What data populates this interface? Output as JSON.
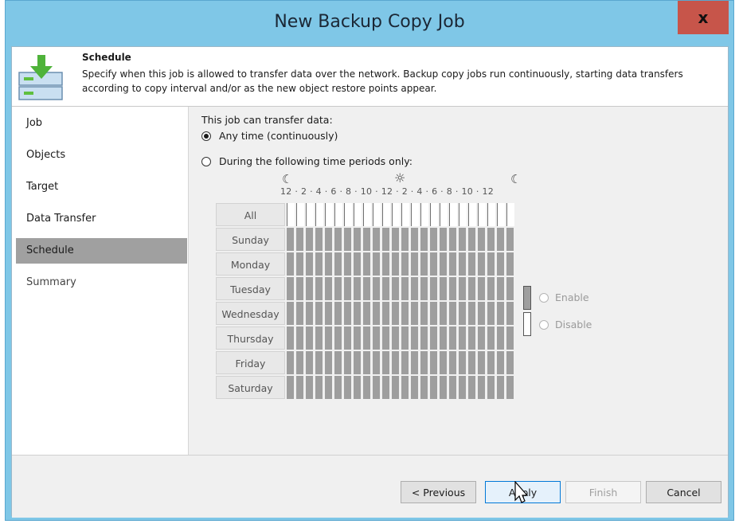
{
  "window": {
    "title": "New Backup Copy Job",
    "close_glyph": "x"
  },
  "header": {
    "title": "Schedule",
    "description": "Specify when this job is allowed to transfer data over the network. Backup copy jobs run continuously, starting data transfers according to copy interval and/or as the new object restore points appear.",
    "icon": "backup-copy-download-icon"
  },
  "sidebar": {
    "items": [
      {
        "label": "Job",
        "state": "normal"
      },
      {
        "label": "Objects",
        "state": "normal"
      },
      {
        "label": "Target",
        "state": "normal"
      },
      {
        "label": "Data Transfer",
        "state": "normal"
      },
      {
        "label": "Schedule",
        "state": "active"
      },
      {
        "label": "Summary",
        "state": "disabled"
      }
    ]
  },
  "schedule": {
    "prompt": "This job can transfer data:",
    "option_any": "Any time (continuously)",
    "option_periods": "During the following time periods only:",
    "selected": "any",
    "hour_scale": "12 · 2 · 4 · 6 · 8 · 10 · 12 · 2 · 4 · 6 · 8 · 10 · 12",
    "all_label": "All",
    "days": [
      "Sunday",
      "Monday",
      "Tuesday",
      "Wednesday",
      "Thursday",
      "Friday",
      "Saturday"
    ],
    "enable_label": "Enable",
    "disable_label": "Disable"
  },
  "footer": {
    "previous": "< Previous",
    "apply": "Apply",
    "finish": "Finish",
    "cancel": "Cancel"
  },
  "colors": {
    "title_bar": "#7fc7e7",
    "close_button": "#c7554a",
    "grid_filled": "#9e9e9e",
    "active_sidebar": "#a0a0a0"
  }
}
